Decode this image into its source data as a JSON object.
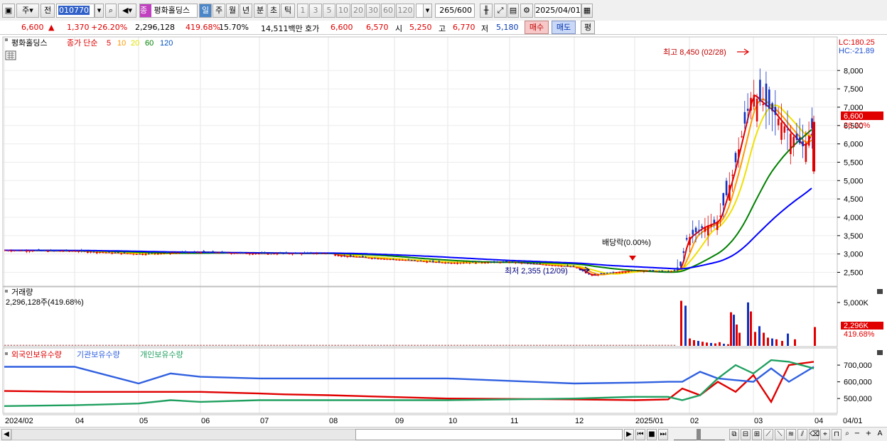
{
  "toolbar": {
    "type_select": "주",
    "prefix": "전",
    "code": "010770",
    "name_badge": "종",
    "stock_name": "평화홀딩스",
    "periods": [
      "일",
      "주",
      "월",
      "년",
      "분",
      "초",
      "틱"
    ],
    "active_period": "일",
    "minute_presets": [
      "1",
      "3",
      "5",
      "10",
      "20",
      "30",
      "60",
      "120"
    ],
    "count_value": "265",
    "count_max": "/600",
    "date": "2025/04/01"
  },
  "quote": {
    "price": "6,600",
    "arrow": "▲",
    "change": "1,370",
    "change_pct": "+26.20%",
    "volume": "2,296,128",
    "volume_pct": "419.68%",
    "turnover": "15.70%",
    "amount": "14,511백만",
    "bid_label": "호가",
    "ask_price": "6,600",
    "bid_price": "6,570",
    "open_label": "시",
    "open": "5,250",
    "high_label": "고",
    "high": "6,770",
    "low_label": "저",
    "low": "5,180",
    "buy_button": "매수",
    "sell_button": "매도",
    "eval_button": "평"
  },
  "price_panel": {
    "legend_name": "평화홀딩스",
    "legend_ma_label": "종가 단순",
    "ma_periods": [
      "5",
      "10",
      "20",
      "60",
      "120"
    ],
    "ma_colors": [
      "#e00000",
      "#ff9900",
      "#ffff00",
      "#008000",
      "#0000ff"
    ],
    "lc_label": "LC:180.25",
    "hc_label": "HC:-21.89",
    "high_annotation": "최고 8,450 (02/28)",
    "low_annotation": "최저 2,355 (12/09)",
    "dividend_annotation": "배당락(0.00%)",
    "current_price_tag": "6,600",
    "current_pct_tag": "26.20%",
    "y_ticks": [
      "8,000",
      "7,500",
      "7,000",
      "6,500",
      "6,000",
      "5,500",
      "5,000",
      "4,500",
      "4,000",
      "3,500",
      "3,000",
      "2,500"
    ]
  },
  "volume_panel": {
    "title": "거래량",
    "value_label": "2,296,128주(419.68%)",
    "y_ticks": [
      "5,000K"
    ],
    "current_tag": "2,296K",
    "current_pct": "419.68%"
  },
  "holding_panel": {
    "legend": [
      "외국인보유수량",
      "기관보유수량",
      "개인보유수량"
    ],
    "legend_colors": [
      "#e00000",
      "#3060e0",
      "#20a060"
    ],
    "y_ticks": [
      "700,000",
      "600,000",
      "500,000"
    ]
  },
  "x_axis": [
    "2024/02",
    "04",
    "05",
    "06",
    "07",
    "08",
    "09",
    "10",
    "11",
    "12",
    "2025/01",
    "02",
    "03",
    "04"
  ],
  "x_axis_right": "04/01",
  "chart_data": [
    {
      "type": "candlestick",
      "title": "평화홀딩스",
      "y_range": [
        2200,
        8450
      ],
      "high": {
        "value": 8450,
        "date": "02/28"
      },
      "low": {
        "value": 2355,
        "date": "12/09"
      },
      "last_candle": {
        "open": 5250,
        "high": 6770,
        "low": 5180,
        "close": 6600
      },
      "close_path": [
        [
          "2024/02",
          3100
        ],
        [
          "03",
          3080
        ],
        [
          "04",
          3000
        ],
        [
          "05",
          3050
        ],
        [
          "06",
          3010
        ],
        [
          "07",
          3020
        ],
        [
          "08",
          2950
        ],
        [
          "08b",
          2850
        ],
        [
          "09",
          2760
        ],
        [
          "10",
          2780
        ],
        [
          "11",
          2650
        ],
        [
          "12",
          2420
        ],
        [
          "12b",
          2550
        ],
        [
          "2025/01",
          2520
        ],
        [
          "01b",
          2560
        ],
        [
          "02a",
          3400
        ],
        [
          "02b",
          3700
        ],
        [
          "02c",
          3900
        ],
        [
          "02d",
          5200
        ],
        [
          "02/28",
          7400
        ],
        [
          "03a",
          7200
        ],
        [
          "03b",
          6900
        ],
        [
          "03c",
          6300
        ],
        [
          "03d",
          5900
        ],
        [
          "04/01",
          6600
        ]
      ]
    },
    {
      "type": "bar",
      "title": "거래량",
      "note": "volume in K shares",
      "values": [
        5500,
        4900,
        900,
        700,
        600,
        500,
        400,
        350,
        300,
        450,
        250,
        200,
        4100,
        3800,
        2600,
        1600,
        5300,
        4200,
        1700,
        2400,
        1600,
        1000,
        900,
        800,
        600,
        1500,
        800,
        2296
      ]
    },
    {
      "type": "line",
      "title": "보유수량",
      "series": [
        {
          "name": "외국인보유수량",
          "values": [
            545000,
            540000,
            540000,
            540000,
            540000,
            530000,
            525000,
            520000,
            500000,
            495000,
            490000,
            495000,
            560000,
            520000,
            600000,
            540000,
            640000,
            480000,
            700000,
            720000
          ]
        },
        {
          "name": "기관보유수량",
          "values": [
            690000,
            690000,
            590000,
            650000,
            630000,
            620000,
            620000,
            620000,
            620000,
            590000,
            595000,
            600000,
            600000,
            660000,
            620000,
            610000,
            600000,
            680000,
            600000,
            690000
          ]
        },
        {
          "name": "개인보유수량",
          "values": [
            455000,
            460000,
            470000,
            490000,
            480000,
            490000,
            490000,
            490000,
            490000,
            500000,
            510000,
            510000,
            490000,
            520000,
            620000,
            700000,
            650000,
            730000,
            720000,
            680000
          ]
        }
      ]
    }
  ]
}
